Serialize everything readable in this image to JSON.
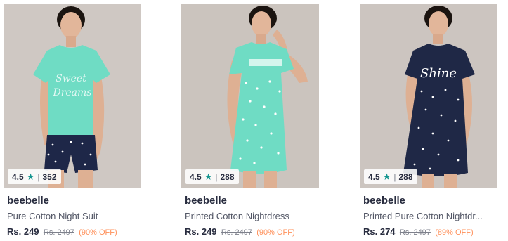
{
  "products": [
    {
      "brand": "beebelle",
      "name": "Pure Cotton Night Suit",
      "price": "Rs. 249",
      "mrp": "Rs. 2497",
      "discount": "(90% OFF)",
      "rating": "4.5",
      "rating_count": "352",
      "rating_icon": "star-icon",
      "image_desc": "mint-green-tshirt-navy-star-shorts"
    },
    {
      "brand": "beebelle",
      "name": "Printed Cotton Nightdress",
      "price": "Rs. 249",
      "mrp": "Rs. 2497",
      "discount": "(90% OFF)",
      "rating": "4.5",
      "rating_count": "288",
      "rating_icon": "star-icon",
      "image_desc": "mint-green-star-print-nightdress"
    },
    {
      "brand": "beebelle",
      "name": "Printed Pure Cotton Nightdr...",
      "price": "Rs. 274",
      "mrp": "Rs. 2497",
      "discount": "(89% OFF)",
      "rating": "4.5",
      "rating_count": "288",
      "rating_icon": "star-icon",
      "image_desc": "navy-star-print-nightdress"
    }
  ],
  "colors": {
    "star": "#14958f",
    "discount": "#ff905a",
    "text_primary": "#282c3f",
    "text_secondary": "#535766",
    "mint": "#6fdcc4",
    "navy": "#1f2846"
  }
}
